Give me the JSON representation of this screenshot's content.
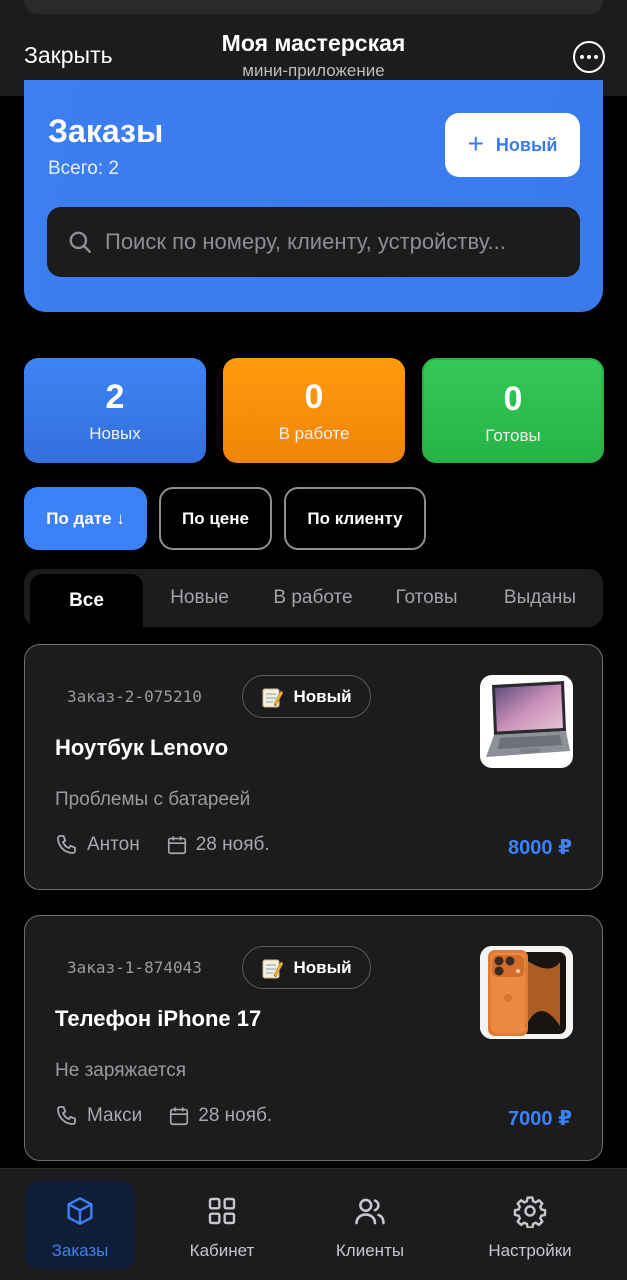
{
  "topbar": {
    "close_label": "Закрыть",
    "title": "Моя мастерская",
    "subtitle": "мини-приложение",
    "more_icon": "more-circle-icon"
  },
  "hero": {
    "title": "Заказы",
    "total": "Всего: 2",
    "new_button": {
      "icon": "plus-icon",
      "label": "Новый"
    },
    "search": {
      "placeholder": "Поиск по номеру, клиенту, устройству..."
    }
  },
  "stats": [
    {
      "value": "2",
      "label": "Новых",
      "color": "#3c82f6"
    },
    {
      "value": "0",
      "label": "В работе",
      "color": "#ff9500"
    },
    {
      "value": "0",
      "label": "Готовы",
      "color": "#30c050"
    }
  ],
  "sort": [
    {
      "label": "По дате ↓",
      "active": true
    },
    {
      "label": "По цене",
      "active": false
    },
    {
      "label": "По клиенту",
      "active": false
    }
  ],
  "tabs": [
    {
      "label": "Все",
      "active": true
    },
    {
      "label": "Новые",
      "active": false
    },
    {
      "label": "В работе",
      "active": false
    },
    {
      "label": "Готовы",
      "active": false
    },
    {
      "label": "Выданы",
      "active": false
    }
  ],
  "orders": [
    {
      "code": "Заказ-2-075210",
      "status": "Новый",
      "status_icon": "memo-icon",
      "device": "Ноутбук Lenovo",
      "issue": "Проблемы с батареей",
      "client": "Антон",
      "date": "28 нояб.",
      "price": "8000 ₽",
      "image": "laptop-image"
    },
    {
      "code": "Заказ-1-874043",
      "status": "Новый",
      "status_icon": "memo-icon",
      "device": "Телефон iPhone 17",
      "issue": "Не заряжается",
      "client": "Макси",
      "date": "28 нояб.",
      "price": "7000 ₽",
      "image": "phone-image"
    }
  ],
  "bottom_nav": [
    {
      "label": "Заказы",
      "icon": "box-icon",
      "active": true
    },
    {
      "label": "Кабинет",
      "icon": "grid-icon",
      "active": false
    },
    {
      "label": "Клиенты",
      "icon": "users-icon",
      "active": false
    },
    {
      "label": "Настройки",
      "icon": "gear-icon",
      "active": false
    }
  ],
  "colors": {
    "accent": "#3c82f6",
    "background": "#000000",
    "surface": "#1c1c1e"
  }
}
